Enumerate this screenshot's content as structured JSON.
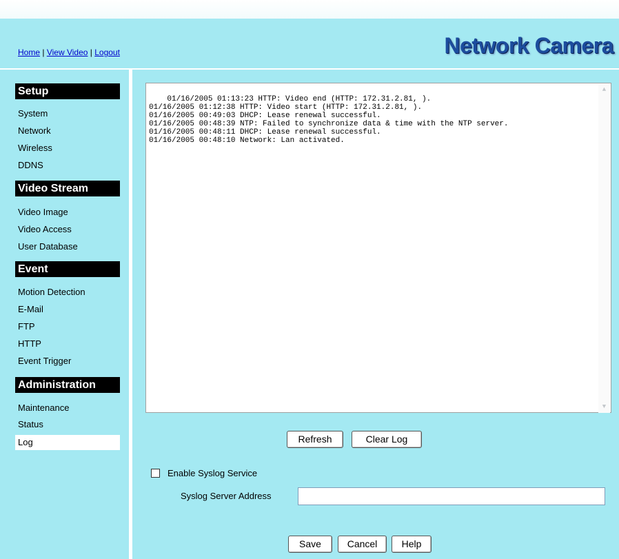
{
  "header": {
    "links": [
      "Home",
      "View Video",
      "Logout"
    ],
    "separator": " | ",
    "brand": "Network Camera"
  },
  "sidebar": {
    "sections": [
      {
        "title": "Setup",
        "items": [
          "System",
          "Network",
          "Wireless",
          "DDNS"
        ]
      },
      {
        "title": "Video Stream",
        "items": [
          "Video Image",
          "Video Access",
          "User Database"
        ]
      },
      {
        "title": "Event",
        "items": [
          "Motion Detection",
          "E-Mail",
          "FTP",
          "HTTP",
          "Event Trigger"
        ]
      },
      {
        "title": "Administration",
        "items": [
          "Maintenance",
          "Status",
          "Log"
        ]
      }
    ],
    "active_item": "Log"
  },
  "log": {
    "entries": "01/16/2005 01:13:23 HTTP: Video end (HTTP: 172.31.2.81, ).\n01/16/2005 01:12:38 HTTP: Video start (HTTP: 172.31.2.81, ).\n01/16/2005 00:49:03 DHCP: Lease renewal successful.\n01/16/2005 00:48:39 NTP: Failed to synchronize data & time with the NTP server.\n01/16/2005 00:48:11 DHCP: Lease renewal successful.\n01/16/2005 00:48:10 Network: Lan activated."
  },
  "buttons": {
    "refresh": "Refresh",
    "clear_log": "Clear Log",
    "save": "Save",
    "cancel": "Cancel",
    "help": "Help"
  },
  "syslog": {
    "enable_label": "Enable Syslog Service",
    "enabled": false,
    "server_label": "Syslog Server Address",
    "server_value": ""
  },
  "colors": {
    "background": "#a4e9f2",
    "brand": "#1c4d9e",
    "link": "#0000cc"
  }
}
